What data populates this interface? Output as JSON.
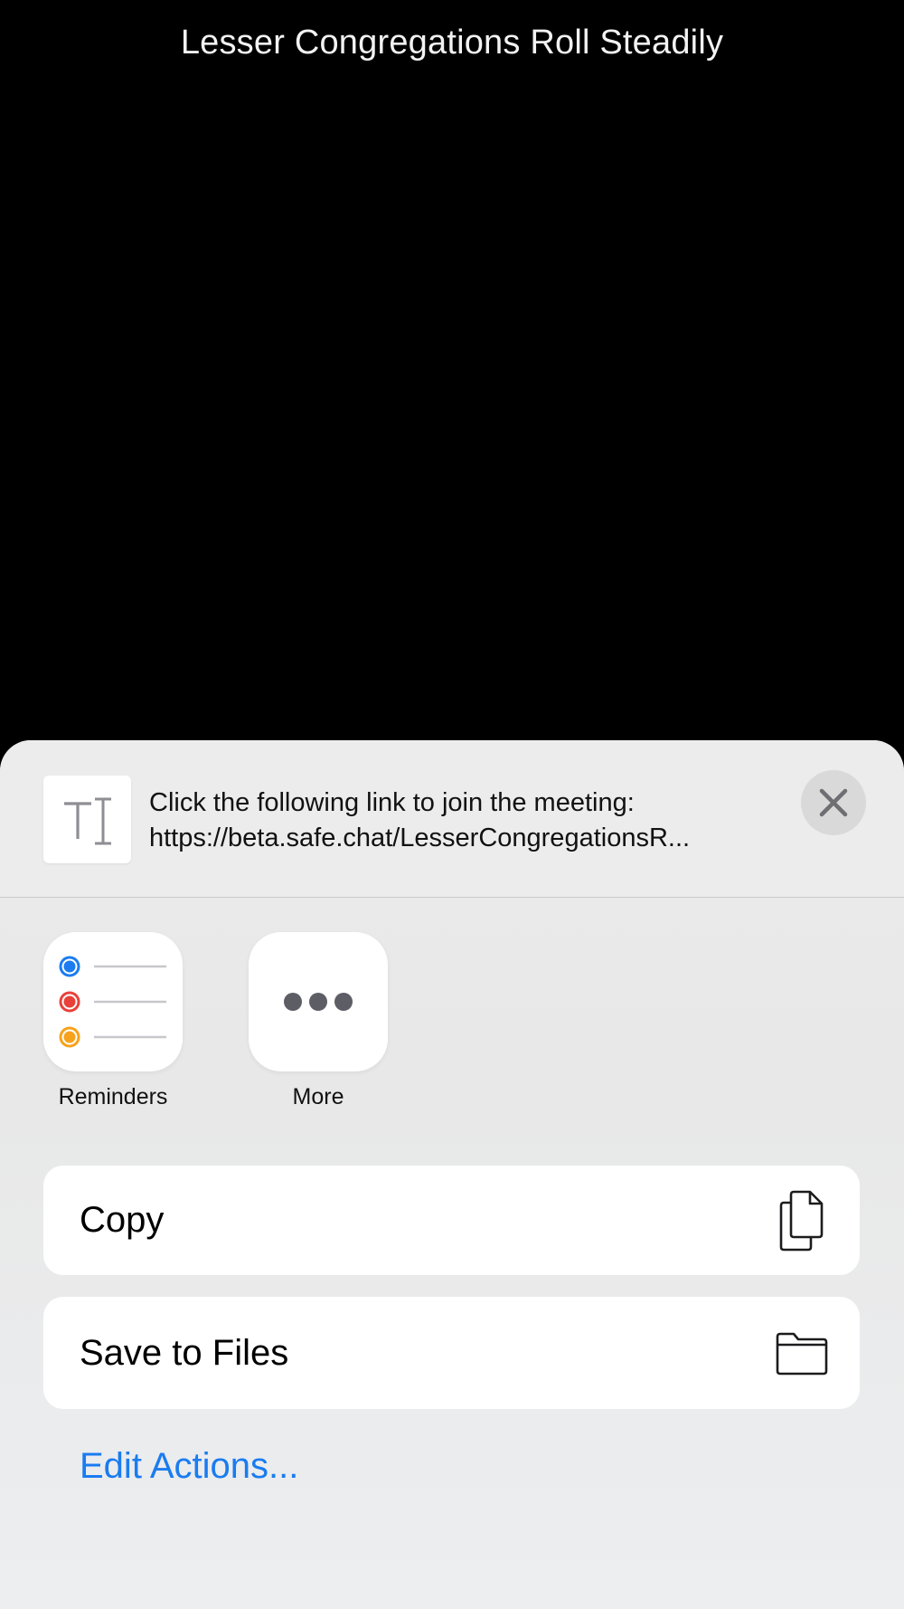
{
  "meeting": {
    "title": "Lesser Congregations Roll Steadily"
  },
  "share_sheet": {
    "preview": {
      "line1": "Click the following link to join the meeting:",
      "line2": "https://beta.safe.chat/LesserCongregationsR..."
    },
    "apps": [
      {
        "label": "Reminders",
        "icon": "reminders-icon"
      },
      {
        "label": "More",
        "icon": "more-icon"
      }
    ],
    "actions": [
      {
        "label": "Copy",
        "icon": "copy-icon"
      },
      {
        "label": "Save to Files",
        "icon": "folder-icon"
      }
    ],
    "edit_actions_label": "Edit Actions...",
    "colors": {
      "accent": "#1a7cf0",
      "reminder_blue": "#1a7cf0",
      "reminder_red": "#e8413a",
      "reminder_orange": "#f7a21c"
    }
  }
}
